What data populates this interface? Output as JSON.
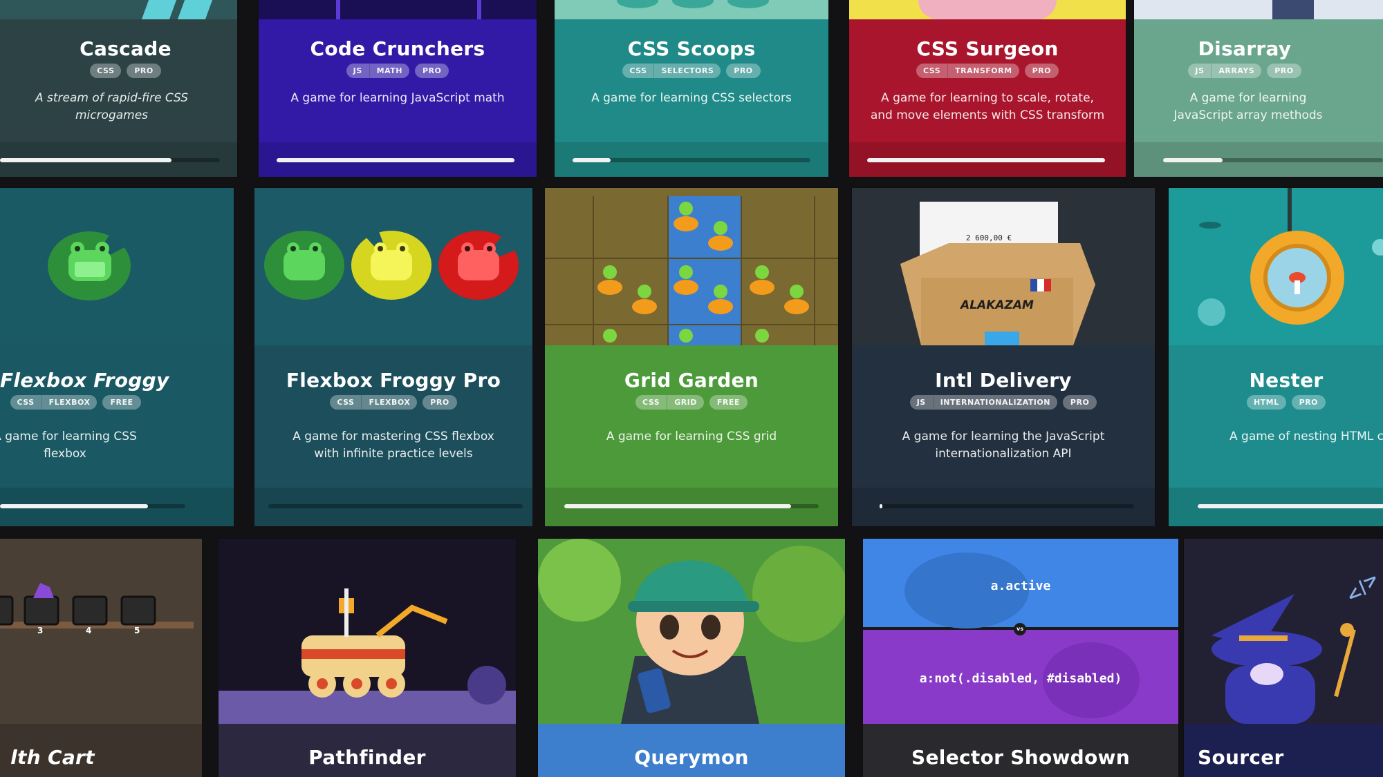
{
  "cards": [
    {
      "title": "Cascade",
      "tags": [
        "CSS"
      ],
      "plan": "PRO",
      "desc": "A stream of rapid-fire CSS microgames",
      "progress": 0.78
    },
    {
      "title": "Code Crunchers",
      "tags": [
        "JS",
        "MATH"
      ],
      "plan": "PRO",
      "desc": "A game for learning JavaScript math",
      "progress": 1.0
    },
    {
      "title": "CSS Scoops",
      "tags": [
        "CSS",
        "SELECTORS"
      ],
      "plan": "PRO",
      "desc": "A game for learning CSS selectors",
      "progress": 0.16
    },
    {
      "title": "CSS Surgeon",
      "tags": [
        "CSS",
        "TRANSFORM"
      ],
      "plan": "PRO",
      "desc": "A game for learning to scale, rotate, and move elements with CSS transform",
      "progress": 1.0
    },
    {
      "title": "Disarray",
      "tags": [
        "JS",
        "ARRAYS"
      ],
      "plan": "PRO",
      "desc": "A game for learning JavaScript array methods",
      "progress": 0.27
    },
    {
      "title": "Flexbox Froggy",
      "tags": [
        "CSS",
        "FLEXBOX"
      ],
      "plan": "FREE",
      "desc": "A game for learning CSS flexbox",
      "progress": 0.8
    },
    {
      "title": "Flexbox Froggy Pro",
      "tags": [
        "CSS",
        "FLEXBOX"
      ],
      "plan": "PRO",
      "desc": "A game for mastering CSS flexbox with infinite practice levels",
      "progress": 0.0
    },
    {
      "title": "Grid Garden",
      "tags": [
        "CSS",
        "GRID"
      ],
      "plan": "FREE",
      "desc": "A game for learning CSS grid",
      "progress": 0.89
    },
    {
      "title": "Intl Delivery",
      "tags": [
        "JS",
        "INTERNATIONALIZATION"
      ],
      "plan": "PRO",
      "desc": "A game for learning the JavaScript internationalization API",
      "progress": 0.01,
      "art_text": "2 600,00 €",
      "box_text": "ALAKAZAM"
    },
    {
      "title": "Nester",
      "tags": [
        "HTML"
      ],
      "plan": "PRO",
      "desc": "A game of nesting HTML co",
      "progress": 0.9
    },
    {
      "title": "lth Cart",
      "cart_numbers": [
        "3",
        "4",
        "5"
      ]
    },
    {
      "title": "Pathfinder"
    },
    {
      "title": "Querymon"
    },
    {
      "title": "Selector Showdown",
      "code_top": "a.active",
      "code_bottom": "a:not(.disabled, #disabled)",
      "vs": "vs"
    },
    {
      "title": "Sourcer",
      "scribble": "</>"
    }
  ],
  "colors": {
    "cascade": "#2c4245",
    "crunchers": "#321aa6",
    "scoops": "#1f8a87",
    "surgeon": "#a8152c",
    "disarray": "#6aa58e",
    "froggy": "#1a5964",
    "froggypro": "#1c4f5b",
    "garden": "#4d9a3a",
    "intl": "#23303f",
    "nester": "#1e8c8c",
    "cart": "#3c342c",
    "pathfinder": "#2c2840",
    "querymon": "#3d7fcc",
    "showdown": "#2a2a2e",
    "sourcer": "#1c2050"
  }
}
